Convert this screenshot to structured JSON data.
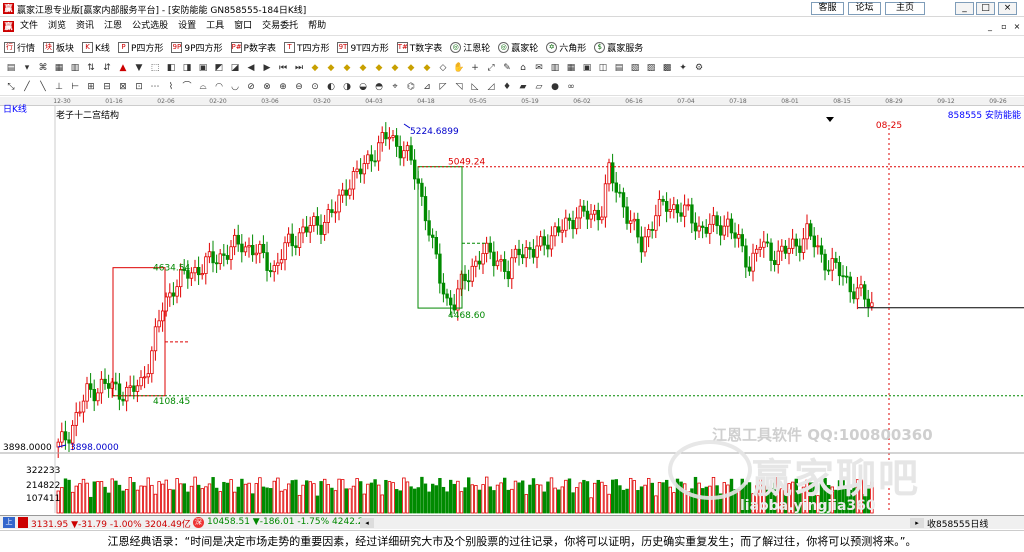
{
  "window": {
    "title": "赢家江恩专业版[赢家内部服务平台] - [安防能能  GN858555-184日K线]",
    "links": [
      "客服",
      "论坛",
      "主页"
    ],
    "controls": [
      "_",
      "□",
      "×"
    ]
  },
  "menu": [
    "文件",
    "浏览",
    "资讯",
    "江恩",
    "公式选股",
    "设置",
    "工具",
    "窗口",
    "交易委托",
    "帮助"
  ],
  "toolbar": [
    {
      "icon": "行",
      "label": "行情"
    },
    {
      "icon": "块",
      "label": "板块"
    },
    {
      "icon": "K",
      "label": "K线"
    },
    {
      "icon": "P",
      "label": "P四方形"
    },
    {
      "icon": "9P",
      "label": "9P四方形"
    },
    {
      "icon": "P#",
      "label": "P数字表"
    },
    {
      "icon": "T",
      "label": "T四方形"
    },
    {
      "icon": "9T",
      "label": "9T四方形"
    },
    {
      "icon": "T#",
      "label": "T数字表"
    },
    {
      "icon": "◎",
      "label": "江恩轮"
    },
    {
      "icon": "◎",
      "label": "赢家轮"
    },
    {
      "icon": "✡",
      "label": "六角形"
    },
    {
      "icon": "$",
      "label": "赢家服务"
    }
  ],
  "toolbar2": [
    "▤",
    "▾",
    "⌘",
    "▦",
    "▥",
    "⇅",
    "⇵",
    "▲",
    "▼",
    "⬚",
    "◧",
    "◨",
    "▣",
    "◩",
    "◪",
    "◀",
    "▶",
    "⏮",
    "⏭",
    "◆",
    "◆",
    "◆",
    "◆",
    "◆",
    "◆",
    "◆",
    "◆",
    "◇",
    "✋",
    "+",
    "⤢",
    "✎",
    "⌂",
    "✉",
    "▥",
    "▦",
    "▣",
    "◫",
    "▤",
    "▧",
    "▨",
    "▩",
    "✦",
    "⚙"
  ],
  "toolbar3": [
    "⤡",
    "╱",
    "╲",
    "⊥",
    "⊢",
    "⊞",
    "⊟",
    "⊠",
    "⊡",
    "⋯",
    "⌇",
    "⌒",
    "⌓",
    "◠",
    "◡",
    "⊘",
    "⊗",
    "⊕",
    "⊖",
    "⊙",
    "◐",
    "◑",
    "◒",
    "◓",
    "⌖",
    "⌬",
    "⊿",
    "◸",
    "◹",
    "◺",
    "◿",
    "♦",
    "▰",
    "▱",
    "●",
    "∞"
  ],
  "timeaxis": [
    "12-30",
    "01-16",
    "02-06",
    "02-20",
    "03-06",
    "03-20",
    "04-03",
    "04-18",
    "05-05",
    "05-19",
    "06-02",
    "06-16",
    "07-04",
    "07-18",
    "08-01",
    "08-15",
    "08-29",
    "09-12",
    "09-26"
  ],
  "chart": {
    "period": "日K线",
    "title": "老子十二宫结构",
    "symbol": "858555  安防能能",
    "marker_date": "08-25",
    "price_labels": {
      "high": "5224.6899",
      "level1": "5049.24",
      "level2": "4634.54",
      "low_box": "4468.60",
      "level3": "4108.45",
      "left_low": "3898.0000",
      "low": "3898.0000"
    },
    "volume_labels": [
      "322233",
      "214822",
      "107411"
    ]
  },
  "statusbar": {
    "index1": "3131.95 ▼-31.79 -1.00% 3204.49亿",
    "index2": "10458.51 ▼-186.01 -1.75% 4242.2",
    "right": "收858555日线"
  },
  "watermark": {
    "line1": "江恩工具软件  QQ:100800360",
    "logo_text": "赢家聊吧",
    "url": "liaoba.yingjia360"
  },
  "quote": "江恩经典语录：“时间是决定市场走势的重要因素，经过详细研究大市及个别股票的过往记录，你将可以证明，历史确实重复发生；而了解过往，你将可以预测将来。”。",
  "colors": {
    "up": "#e00000",
    "down": "#008a00",
    "accent": "#0000c8"
  }
}
